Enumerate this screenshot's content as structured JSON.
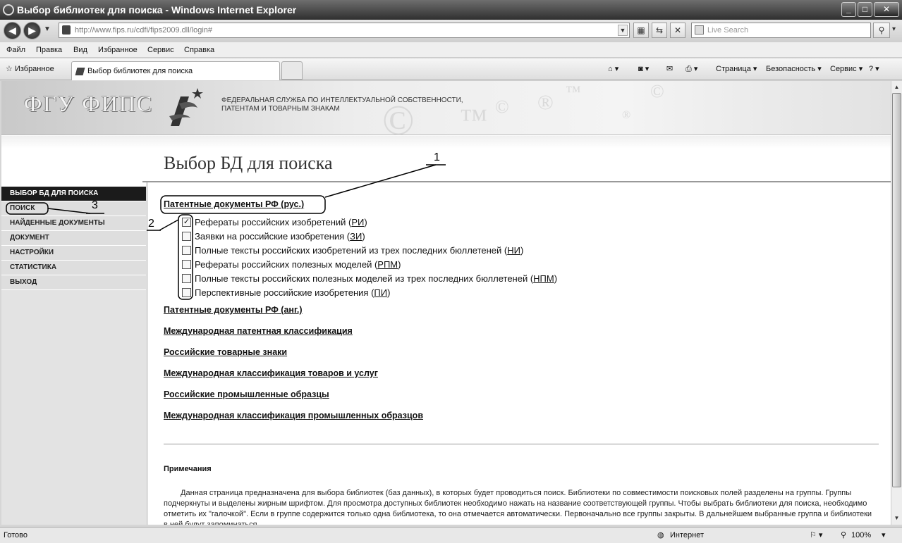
{
  "window": {
    "title": "Выбор библиотек для поиска - Windows Internet Explorer",
    "minimize": "_",
    "maximize": "□",
    "close": "✕"
  },
  "address": {
    "url": "http://www.fips.ru/cdfi/fips2009.dll/login#",
    "search_placeholder": "Live Search"
  },
  "menu": [
    "Файл",
    "Правка",
    "Вид",
    "Избранное",
    "Сервис",
    "Справка"
  ],
  "favorites": {
    "label": "Избранное",
    "tab_title": "Выбор библиотек для поиска"
  },
  "commandbar": {
    "page": "Страница",
    "security": "Безопасность",
    "service": "Сервис"
  },
  "banner": {
    "logo": "ФГУ ФИПС",
    "agency_line1": "ФЕДЕРАЛЬНАЯ СЛУЖБА ПО ИНТЕЛЛЕКТУАЛЬНОЙ СОБСТВЕННОСТИ,",
    "agency_line2": "ПАТЕНТАМ И ТОВАРНЫМ ЗНАКАМ"
  },
  "page_title": "Выбор БД для поиска",
  "sidebar": [
    {
      "label": "ВЫБОР БД ДЛЯ ПОИСКА",
      "active": true
    },
    {
      "label": "ПОИСК",
      "active": false
    },
    {
      "label": "НАЙДЕННЫЕ ДОКУМЕНТЫ",
      "active": false
    },
    {
      "label": "ДОКУМЕНТ",
      "active": false
    },
    {
      "label": "НАСТРОЙКИ",
      "active": false
    },
    {
      "label": "СТАТИСТИКА",
      "active": false
    },
    {
      "label": "ВЫХОД",
      "active": false
    }
  ],
  "groups": {
    "rus_patents": "Патентные документы РФ (рус.)",
    "eng_patents": "Патентные документы РФ (анг.)",
    "ipc": "Международная патентная классификация",
    "trademarks": "Российские товарные знаки",
    "goods_class": "Международная классификация товаров и услуг",
    "designs": "Российские промышленные образцы",
    "designs_class": "Международная классификация промышленных образцов"
  },
  "databases": [
    {
      "text": "Рефераты российских изобретений (",
      "code": "РИ",
      "checked": true
    },
    {
      "text": "Заявки на российские изобретения (",
      "code": "ЗИ",
      "checked": false
    },
    {
      "text": "Полные тексты российских изобретений из трех последних бюллетеней (",
      "code": "НИ",
      "checked": false
    },
    {
      "text": "Рефераты российских полезных моделей (",
      "code": "РПМ",
      "checked": false
    },
    {
      "text": "Полные тексты российских полезных моделей из трех последних бюллетеней (",
      "code": "НПМ",
      "checked": false
    },
    {
      "text": "Перспективные российские изобретения (",
      "code": "ПИ",
      "checked": false
    }
  ],
  "close_paren": ")",
  "notes": {
    "title": "Примечания",
    "body": "Данная страница предназначена для выбора библиотек (баз данных), в которых будет проводиться поиск. Библиотеки по совместимости поисковых полей разделены на группы. Группы подчеркнуты и выделены жирным шрифтом. Для просмотра доступных библиотек необходимо нажать на название соответствующей группы. Чтобы выбрать библиотеки для поиска, необходимо отметить их \"галочкой\". Если в группе содержится только одна библиотека, то она отмечается автоматически. Первоначально все группы закрыты. В дальнейшем выбранные группа и библиотеки в ней будут запоминаться."
  },
  "annotations": [
    "1",
    "2",
    "3"
  ],
  "status": {
    "left": "Готово",
    "zone": "Интернет",
    "zoom": "100%"
  },
  "icons": {
    "check": "✓"
  }
}
